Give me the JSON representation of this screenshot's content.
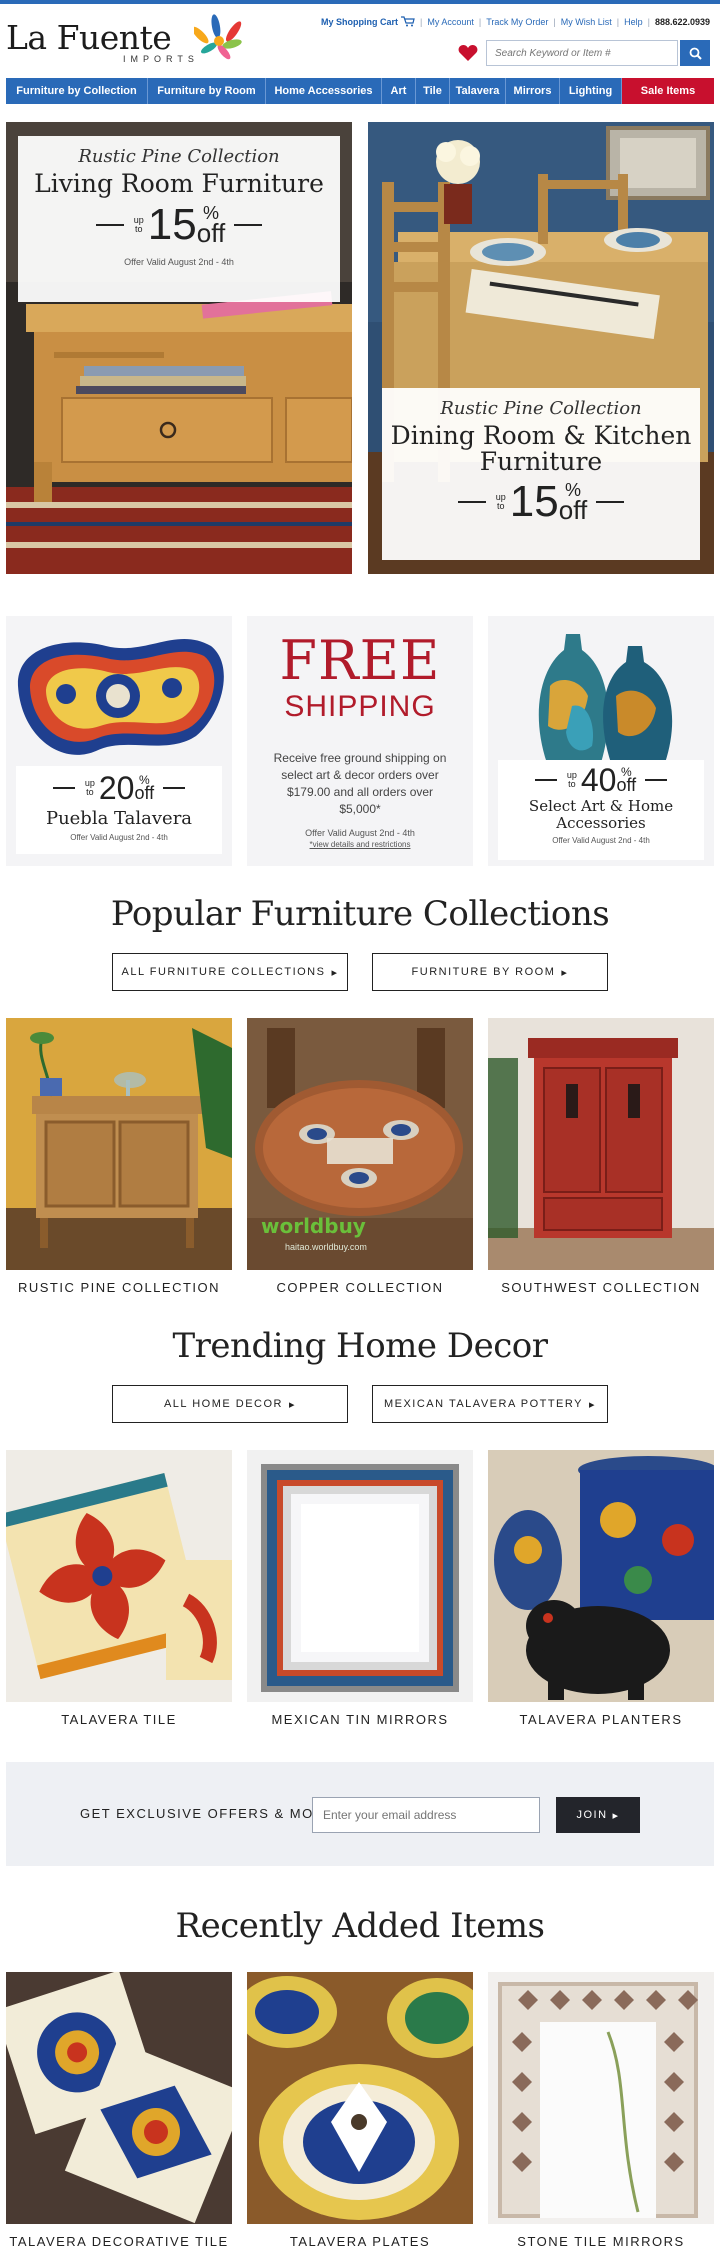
{
  "header": {
    "logo_text": "La Fuente",
    "logo_sub": "IMPORTS",
    "util": {
      "cart": "My Shopping Cart",
      "account": "My Account",
      "track": "Track My Order",
      "wishlist": "My Wish List",
      "help": "Help",
      "phone": "888.622.0939"
    },
    "search_placeholder": "Search Keyword or Item #"
  },
  "nav": [
    "Furniture by Collection",
    "Furniture by Room",
    "Home Accessories",
    "Art",
    "Tile",
    "Talavera",
    "Mirrors",
    "Lighting",
    "Sale Items"
  ],
  "hero": {
    "left": {
      "collection": "Rustic Pine Collection",
      "title": "Living Room Furniture",
      "upto": "up to",
      "percent": "15",
      "pct_sign": "%",
      "off": "off",
      "valid": "Offer Valid August 2nd - 4th"
    },
    "right": {
      "collection": "Rustic Pine Collection",
      "title_1": "Dining Room & Kitchen",
      "title_2": "Furniture",
      "upto": "up to",
      "percent": "15",
      "pct_sign": "%",
      "off": "off"
    }
  },
  "promos": {
    "talavera": {
      "upto": "up to",
      "percent": "20",
      "pct_sign": "%",
      "off": "off",
      "title": "Puebla Talavera",
      "valid": "Offer Valid August 2nd - 4th"
    },
    "shipping": {
      "title": "FREE",
      "subtitle": "SHIPPING",
      "body": "Receive free ground shipping on select art & decor orders over $179.00 and all orders over $5,000*",
      "valid": "Offer Valid August 2nd - 4th",
      "link": "*view details and restrictions"
    },
    "art": {
      "upto": "up to",
      "percent": "40",
      "pct_sign": "%",
      "off": "off",
      "title_1": "Select Art & Home",
      "title_2": "Accessories",
      "valid": "Offer Valid August 2nd - 4th"
    }
  },
  "furniture": {
    "heading": "Popular Furniture Collections",
    "btn_all": "ALL FURNITURE COLLECTIONS",
    "btn_room": "FURNITURE BY ROOM",
    "items": [
      "RUSTIC PINE COLLECTION",
      "COPPER COLLECTION",
      "SOUTHWEST COLLECTION"
    ],
    "watermark": "worldbuy",
    "watermark_url": "haitao.worldbuy.com"
  },
  "decor": {
    "heading": "Trending Home Decor",
    "btn_all": "ALL HOME DECOR",
    "btn_talavera": "MEXICAN TALAVERA POTTERY",
    "items": [
      "TALAVERA TILE",
      "MEXICAN TIN MIRRORS",
      "TALAVERA PLANTERS"
    ]
  },
  "newsletter": {
    "label": "GET EXCLUSIVE OFFERS & MORE!",
    "placeholder": "Enter your email address",
    "button": "JOIN"
  },
  "recent": {
    "heading": "Recently Added Items",
    "items": [
      "TALAVERA DECORATIVE TILE",
      "TALAVERA PLATES",
      "STONE TILE MIRRORS"
    ]
  },
  "colors": {
    "brand_blue": "#2a6ab8",
    "sale_red": "#c8102e",
    "free_red": "#b11b2b",
    "heart_red": "#c8102e"
  }
}
